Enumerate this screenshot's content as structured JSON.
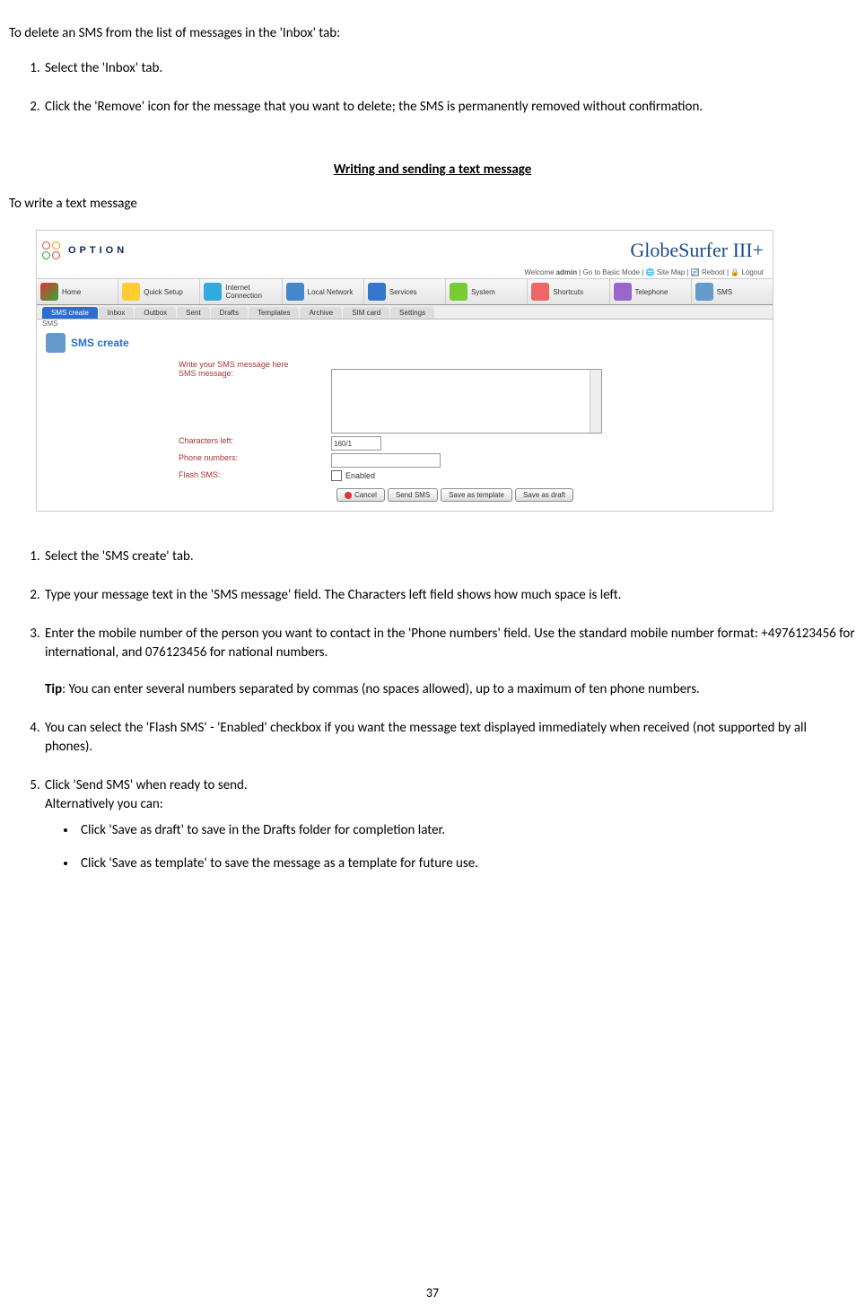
{
  "intro": "To delete an SMS from the list of messages in the 'Inbox' tab:",
  "delete_steps": [
    "Select the 'Inbox' tab.",
    "Click the 'Remove' icon for the message that you want to delete; the SMS is permanently removed without confirmation."
  ],
  "section_heading": "Writing and sending a text message",
  "write_intro": "To write a text message",
  "screenshot": {
    "brand_left": "OPTION",
    "brand_right": "GlobeSurfer III+",
    "welcome_prefix": "Welcome ",
    "welcome_user": "admin",
    "welcome_links": " | Go to Basic Mode | 🌐 Site Map | 🔄 Reboot | 🔒 Logout",
    "main_tabs": [
      "Home",
      "Quick Setup",
      "Internet Connection",
      "Local Network",
      "Services",
      "System",
      "Shortcuts",
      "Telephone",
      "SMS"
    ],
    "sub_tabs": [
      "SMS create",
      "Inbox",
      "Outbox",
      "Sent",
      "Drafts",
      "Templates",
      "Archive",
      "SIM card",
      "Settings"
    ],
    "corner_label": "SMS",
    "page_title": "SMS create",
    "form": {
      "hint": "Write your SMS message here",
      "msg_label": "SMS message:",
      "chars_label": "Characters left:",
      "chars_value": "160/1",
      "phone_label": "Phone numbers:",
      "flash_label": "Flash SMS:",
      "enabled": "Enabled"
    },
    "buttons": {
      "cancel": "Cancel",
      "send": "Send SMS",
      "save_tmpl": "Save as template",
      "save_draft": "Save as draft"
    }
  },
  "write_steps": {
    "s1": "Select the 'SMS create' tab.",
    "s2": "Type your message text in the 'SMS message' field. The Characters left field shows how much space is left.",
    "s3": "Enter the mobile number of the person you want to contact in the 'Phone numbers' field. Use the standard mobile number format: +4976123456 for international, and 076123456 for national numbers.",
    "tip_label": "Tip",
    "tip_body": ": You can enter several numbers separated by commas (no spaces allowed), up to a maximum of ten phone numbers.",
    "s4": "You can select the 'Flash SMS' - 'Enabled' checkbox if you want the message text displayed immediately when received (not supported by all phones).",
    "s5a": "Click 'Send SMS' when ready to send.",
    "s5b": "Alternatively you can:",
    "bullets": [
      "Click 'Save as draft' to save in the Drafts folder for completion later.",
      "Click 'Save as template' to save the message as a template for future use."
    ]
  },
  "page_number": "37"
}
